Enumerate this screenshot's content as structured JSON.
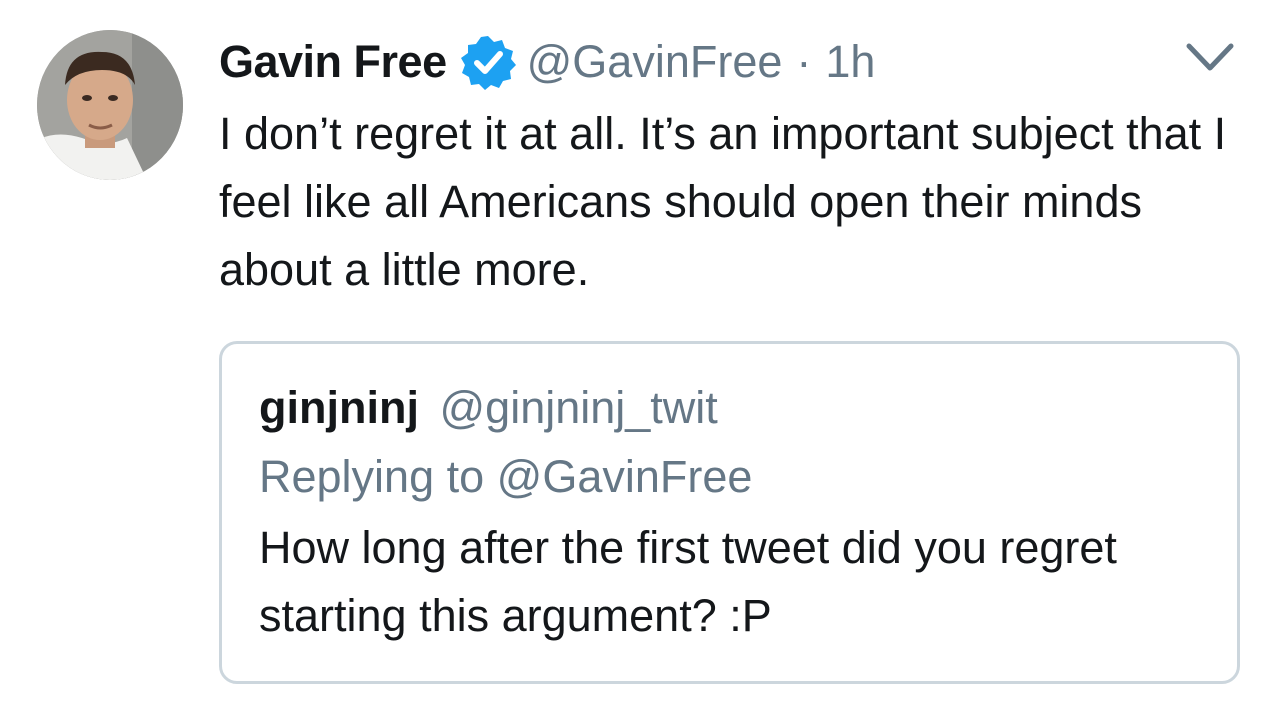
{
  "tweet": {
    "author_name": "Gavin Free",
    "verified_icon": "verified-badge-icon",
    "handle": "@GavinFree",
    "separator": "·",
    "time": "1h",
    "menu_icon": "chevron-down-icon",
    "text": "I don’t regret it at all. It’s an important subject that I feel like all Americans should open their minds about a little more."
  },
  "quoted_tweet": {
    "author_name": "ginjninj",
    "handle": "@ginjninj_twit",
    "replying_to": "Replying to @GavinFree",
    "text": "How long after the first tweet did you regret starting this argument? :P"
  },
  "colors": {
    "primary_text": "#14171a",
    "secondary_text": "#657786",
    "verified_blue": "#1da1f2",
    "border": "#ccd6dd"
  }
}
